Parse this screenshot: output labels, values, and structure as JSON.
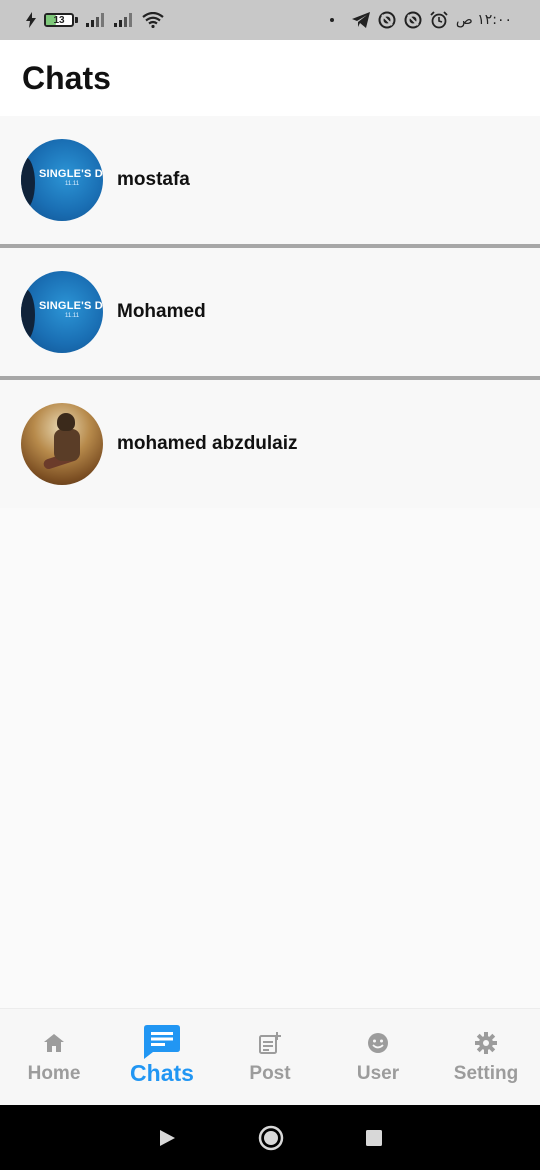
{
  "status_bar": {
    "battery_level": "13",
    "time": "١٢:٠٠ ص",
    "icons": [
      "charging-icon",
      "signal-icon",
      "signal-icon",
      "wifi-icon",
      "telegram-icon",
      "app-icon",
      "app-icon",
      "alarm-icon"
    ]
  },
  "header": {
    "title": "Chats"
  },
  "chats": [
    {
      "name": "mostafa",
      "avatar_text": "SINGLE'S DAY",
      "avatar_sub": "11.11"
    },
    {
      "name": "Mohamed",
      "avatar_text": "SINGLE'S DAY",
      "avatar_sub": "11.11"
    },
    {
      "name": "mohamed abzdulaiz"
    }
  ],
  "bottom_nav": {
    "items": [
      {
        "label": "Home",
        "icon": "home-icon"
      },
      {
        "label": "Chats",
        "icon": "chat-icon",
        "active": true
      },
      {
        "label": "Post",
        "icon": "post-add-icon"
      },
      {
        "label": "User",
        "icon": "user-icon"
      },
      {
        "label": "Setting",
        "icon": "settings-icon"
      }
    ]
  },
  "colors": {
    "accent": "#2196f3",
    "inactive": "#9c9c9c",
    "status_bar_bg": "#c8c8c8",
    "divider": "#a7a7a7"
  }
}
